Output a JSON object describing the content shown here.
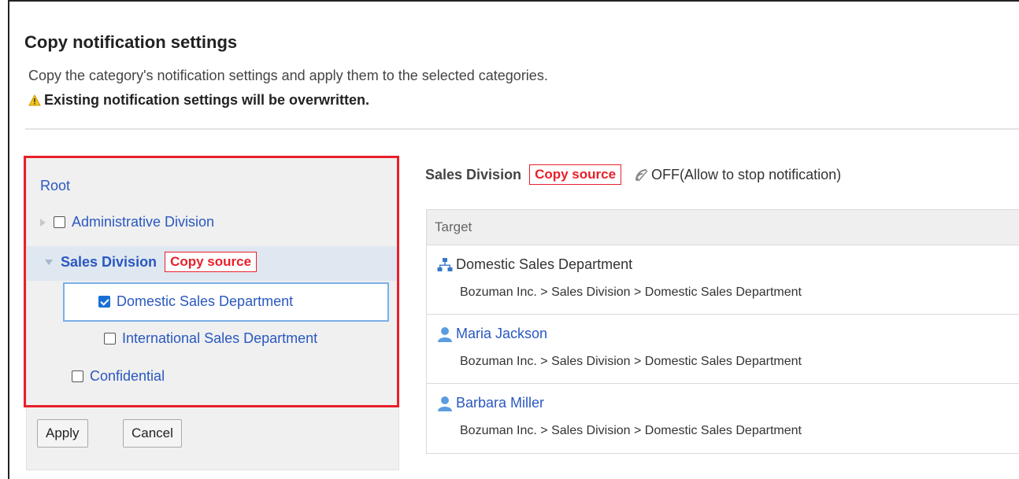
{
  "page": {
    "title": "Copy notification settings",
    "description": "Copy the category's notification settings and apply them to the selected categories.",
    "warning": "Existing notification settings will be overwritten."
  },
  "tree": {
    "root_label": "Root",
    "items": [
      {
        "label": "Administrative Division",
        "checked": false
      },
      {
        "label": "Sales Division",
        "badge": "Copy source"
      },
      {
        "label": "Domestic Sales Department",
        "checked": true
      },
      {
        "label": "International Sales Department",
        "checked": false
      },
      {
        "label": "Confidential",
        "checked": false
      }
    ],
    "buttons": {
      "apply": "Apply",
      "cancel": "Cancel"
    }
  },
  "detail": {
    "category_name": "Sales Division",
    "badge": "Copy source",
    "notification_status": "OFF(Allow to stop notification)",
    "table_header": "Target",
    "rows": [
      {
        "type": "organization",
        "name": "Domestic Sales Department",
        "path": "Bozuman Inc. > Sales Division > Domestic Sales Department"
      },
      {
        "type": "user",
        "name": "Maria Jackson",
        "path": "Bozuman Inc. > Sales Division > Domestic Sales Department"
      },
      {
        "type": "user",
        "name": "Barbara Miller",
        "path": "Bozuman Inc. > Sales Division > Domestic Sales Department"
      }
    ]
  },
  "colors": {
    "link": "#2a58c0",
    "highlight_border": "#e8202a",
    "badge": "#e8202a",
    "checkbox_checked": "#1a6fd6"
  }
}
